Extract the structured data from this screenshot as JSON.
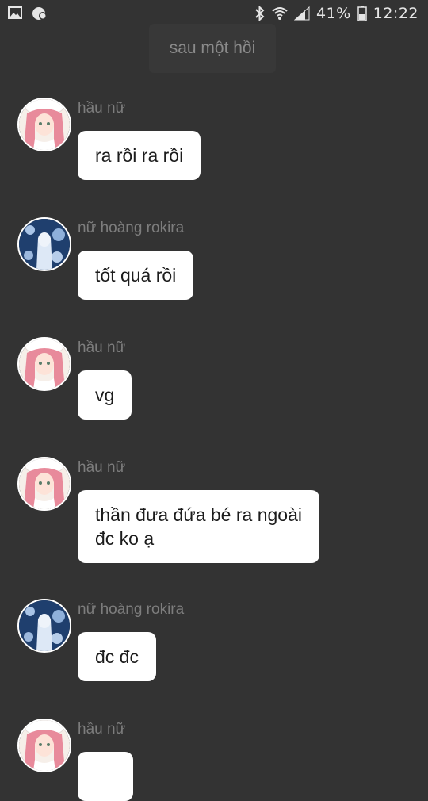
{
  "status_bar": {
    "left_icons": [
      "image-icon",
      "notification-icon"
    ],
    "right_icons": [
      "bluetooth-icon",
      "wifi-icon",
      "signal-icon"
    ],
    "battery": "41%",
    "time": "12:22"
  },
  "time_divider": "sau một hồi",
  "messages": [
    {
      "sender": "hầu nữ",
      "avatar": "pink-hair-avatar",
      "text": "ra rồi ra rồi"
    },
    {
      "sender": "nữ hoàng rokira",
      "avatar": "blue-queen-avatar",
      "text": "tốt quá rồi"
    },
    {
      "sender": "hầu nữ",
      "avatar": "pink-hair-avatar",
      "text": "vg"
    },
    {
      "sender": "hầu nữ",
      "avatar": "pink-hair-avatar",
      "text": "thần đưa đứa bé ra ngoài\nđc ko ạ"
    },
    {
      "sender": "nữ hoàng rokira",
      "avatar": "blue-queen-avatar",
      "text": "đc đc"
    },
    {
      "sender": "hầu nữ",
      "avatar": "pink-hair-avatar",
      "text": ""
    }
  ]
}
